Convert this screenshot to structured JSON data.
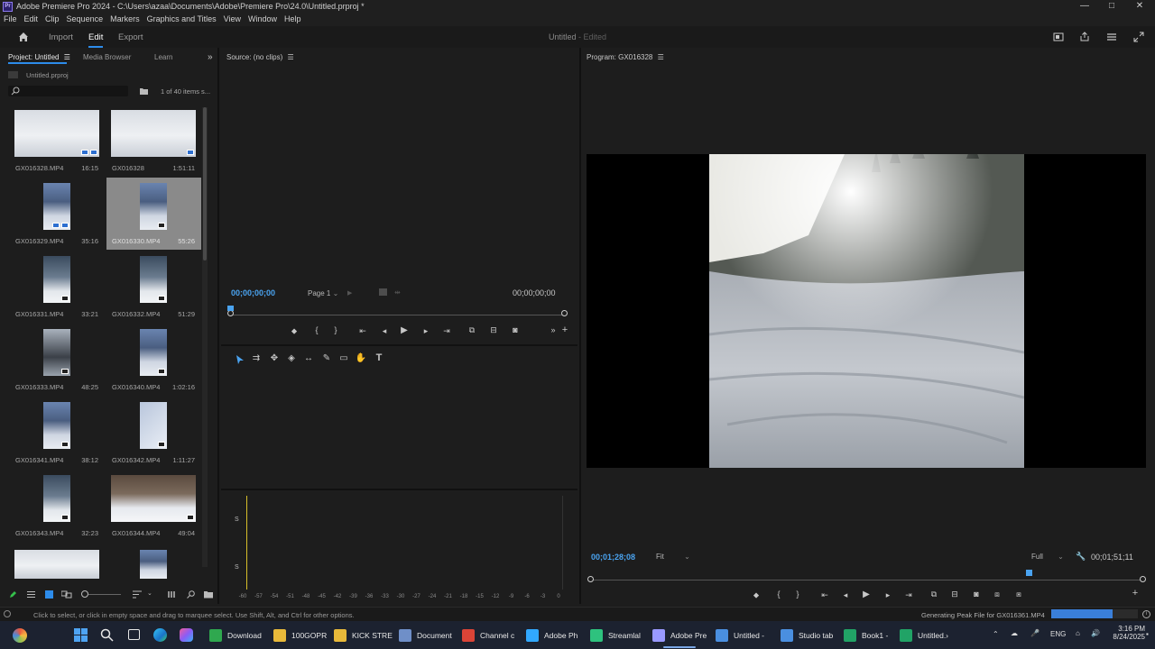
{
  "window": {
    "app_icon": "Pr",
    "title": "Adobe Premiere Pro 2024 - C:\\Users\\azaa\\Documents\\Adobe\\Premiere Pro\\24.0\\Untitled.prproj *",
    "controls": {
      "minimize": "—",
      "maximize": "□",
      "close": "✕"
    }
  },
  "menu": [
    "File",
    "Edit",
    "Clip",
    "Sequence",
    "Markers",
    "Graphics and Titles",
    "View",
    "Window",
    "Help"
  ],
  "header": {
    "workspaces": [
      "Import",
      "Edit",
      "Export"
    ],
    "active_workspace": "Edit",
    "doc_title": "Untitled",
    "doc_state": "- Edited",
    "accent": "#2d8ceb"
  },
  "project_panel": {
    "tabs": [
      "Project: Untitled",
      "Media Browser",
      "Learn"
    ],
    "file": "Untitled.prproj",
    "item_count": "1 of 40 items s...",
    "items": [
      {
        "name": "GX016328.MP4",
        "duration": "16:15"
      },
      {
        "name": "GX016328",
        "duration": "1:51:11"
      },
      {
        "name": "GX016329.MP4",
        "duration": "35:16"
      },
      {
        "name": "GX016330.MP4",
        "duration": "55:26"
      },
      {
        "name": "GX016331.MP4",
        "duration": "33:21"
      },
      {
        "name": "GX016332.MP4",
        "duration": "51:29"
      },
      {
        "name": "GX016333.MP4",
        "duration": "48:25"
      },
      {
        "name": "GX016340.MP4",
        "duration": "1:02:16"
      },
      {
        "name": "GX016341.MP4",
        "duration": "38:12"
      },
      {
        "name": "GX016342.MP4",
        "duration": "1:11:27"
      },
      {
        "name": "GX016343.MP4",
        "duration": "32:23"
      },
      {
        "name": "GX016344.MP4",
        "duration": "49:04"
      }
    ]
  },
  "source_monitor": {
    "title": "Source: (no clips)",
    "timecode_in": "00;00;00;00",
    "page": "Page 1",
    "timecode_out": "00;00;00;00"
  },
  "audio_meter": {
    "solo_labels": [
      "S",
      "S"
    ],
    "scale": [
      "-60",
      "-57",
      "-54",
      "-51",
      "-48",
      "-45",
      "-42",
      "-39",
      "-36",
      "-33",
      "-30",
      "-27",
      "-24",
      "-21",
      "-18",
      "-15",
      "-12",
      "-9",
      "-6",
      "-3",
      "0"
    ]
  },
  "program_monitor": {
    "title": "Program: GX016328",
    "timecode": "00;01;28;08",
    "fit": "Fit",
    "resolution": "Full",
    "duration": "00;01;51;11",
    "playhead_fraction": 0.793
  },
  "status": {
    "hint": "Click to select, or click in empty space and drag to marquee select. Use Shift, Alt, and Ctrl for other options.",
    "background_task": "Generating Peak File for GX016361.MP4",
    "progress_fraction": 0.71
  },
  "taskbar": {
    "items": [
      {
        "label": "Download",
        "color": "#2fa84f"
      },
      {
        "label": "100GOPR",
        "color": "#e8b93a"
      },
      {
        "label": "KICK STRE",
        "color": "#e8b93a"
      },
      {
        "label": "Document",
        "color": "#6f8fc8"
      },
      {
        "label": "Channel c",
        "color": "#db4437"
      },
      {
        "label": "Adobe Ph",
        "color": "#31a8ff"
      },
      {
        "label": "Streamlal",
        "color": "#2ec27e"
      },
      {
        "label": "Adobe Pre",
        "color": "#9999ff"
      },
      {
        "label": "Untitled -",
        "color": "#4a8fe0"
      },
      {
        "label": "Studio tab",
        "color": "#4a8fe0"
      },
      {
        "label": "Book1 -",
        "color": "#21a366"
      },
      {
        "label": "Untitled.›",
        "color": "#21a366"
      }
    ],
    "active_item": "Adobe Pre",
    "language": "ENG",
    "time": "3:16 PM",
    "date": "8/24/2025"
  }
}
